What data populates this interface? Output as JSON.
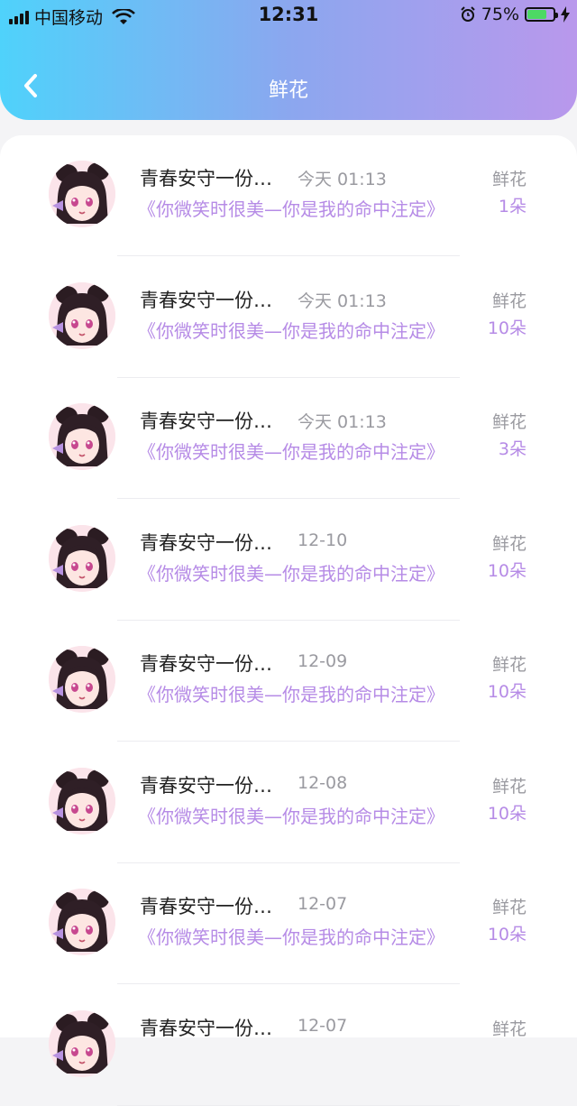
{
  "status": {
    "carrier": "中国移动",
    "time": "12:31",
    "battery": "75%",
    "battery_level": 0.75
  },
  "header": {
    "title": "鲜花"
  },
  "rows": [
    {
      "name": "青春安守一份…",
      "date": "今天 01:13",
      "song": "《你微笑时很美—你是我的命中注定》",
      "tag": "鲜花",
      "count": "1朵"
    },
    {
      "name": "青春安守一份…",
      "date": "今天 01:13",
      "song": "《你微笑时很美—你是我的命中注定》",
      "tag": "鲜花",
      "count": "10朵"
    },
    {
      "name": "青春安守一份…",
      "date": "今天 01:13",
      "song": "《你微笑时很美—你是我的命中注定》",
      "tag": "鲜花",
      "count": "3朵"
    },
    {
      "name": "青春安守一份…",
      "date": "12-10",
      "song": "《你微笑时很美—你是我的命中注定》",
      "tag": "鲜花",
      "count": "10朵"
    },
    {
      "name": "青春安守一份…",
      "date": "12-09",
      "song": "《你微笑时很美—你是我的命中注定》",
      "tag": "鲜花",
      "count": "10朵"
    },
    {
      "name": "青春安守一份…",
      "date": "12-08",
      "song": "《你微笑时很美—你是我的命中注定》",
      "tag": "鲜花",
      "count": "10朵"
    },
    {
      "name": "青春安守一份…",
      "date": "12-07",
      "song": "《你微笑时很美—你是我的命中注定》",
      "tag": "鲜花",
      "count": "10朵"
    },
    {
      "name": "青春安守一份…",
      "date": "12-07",
      "song": "",
      "tag": "鲜花",
      "count": ""
    }
  ]
}
